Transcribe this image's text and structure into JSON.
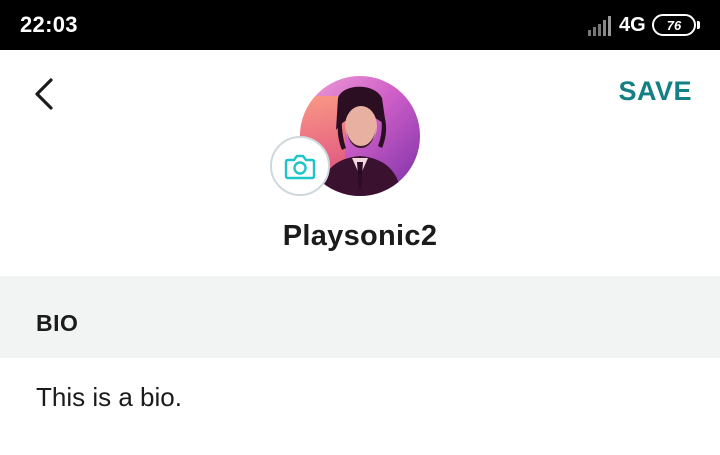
{
  "status_bar": {
    "time": "22:03",
    "network": "4G",
    "battery": "76",
    "signal_icon": "signal-bars-icon",
    "battery_icon": "battery-icon"
  },
  "header": {
    "back_icon": "chevron-left-icon",
    "save_label": "SAVE",
    "accent_color": "#147f86"
  },
  "profile": {
    "avatar_icon": "avatar-photo",
    "camera_icon": "camera-icon",
    "camera_color": "#1fc4c9",
    "username": "Playsonic2"
  },
  "bio": {
    "label": "BIO",
    "text": "This is a bio."
  }
}
